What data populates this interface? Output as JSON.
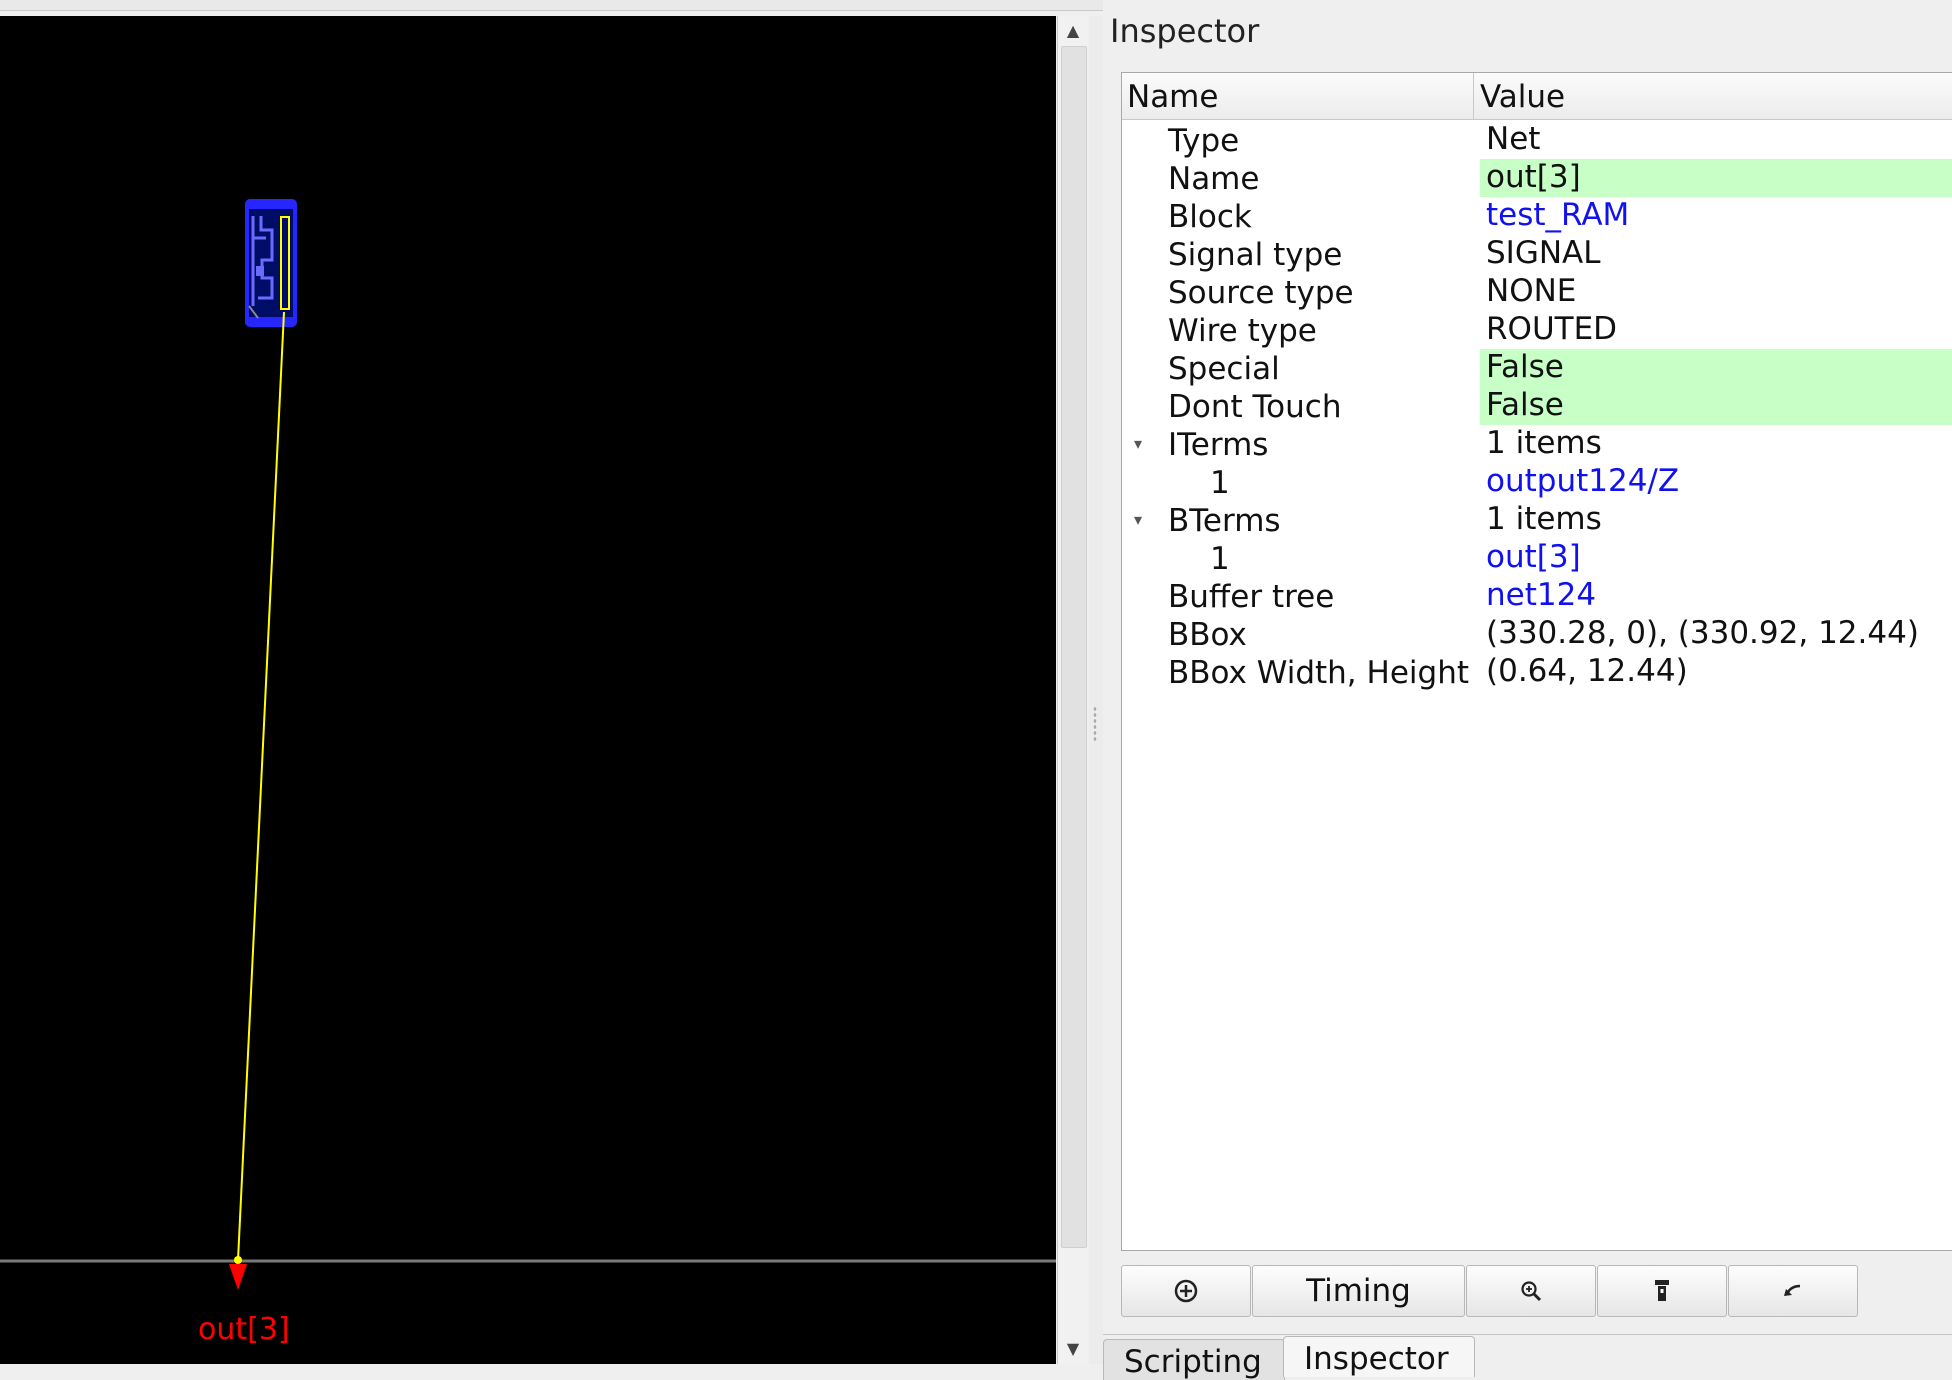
{
  "layout": {
    "pin_label": "out[3]",
    "colors": {
      "background": "#000000",
      "cell": "#2020ff",
      "wire": "#ffff00",
      "pin": "#ff0000"
    }
  },
  "inspector": {
    "title": "Inspector",
    "columns": {
      "name": "Name",
      "value": "Value"
    },
    "rows": [
      {
        "key": "Type",
        "value": "Net",
        "style": "plain"
      },
      {
        "key": "Name",
        "value": "out[3]",
        "style": "highlight"
      },
      {
        "key": "Block",
        "value": "test_RAM",
        "style": "link"
      },
      {
        "key": "Signal type",
        "value": "SIGNAL",
        "style": "plain"
      },
      {
        "key": "Source type",
        "value": "NONE",
        "style": "plain"
      },
      {
        "key": "Wire type",
        "value": "ROUTED",
        "style": "plain"
      },
      {
        "key": "Special",
        "value": "False",
        "style": "highlight"
      },
      {
        "key": "Dont Touch",
        "value": "False",
        "style": "highlight"
      },
      {
        "key": "ITerms",
        "value": "1 items",
        "style": "plain",
        "expandable": true
      },
      {
        "key": "1",
        "value": "output124/Z",
        "style": "link",
        "child": true
      },
      {
        "key": "BTerms",
        "value": "1 items",
        "style": "plain",
        "expandable": true
      },
      {
        "key": "1",
        "value": "out[3]",
        "style": "link",
        "child": true
      },
      {
        "key": "Buffer tree",
        "value": "net124",
        "style": "link"
      },
      {
        "key": "BBox",
        "value": "(330.28, 0), (330.92, 12.44)",
        "style": "plain"
      },
      {
        "key": "BBox Width, Height",
        "value": "(0.64, 12.44)",
        "style": "plain"
      }
    ],
    "buttons": {
      "timing": "Timing"
    },
    "tabs": {
      "scripting": "Scripting",
      "inspector": "Inspector"
    }
  }
}
